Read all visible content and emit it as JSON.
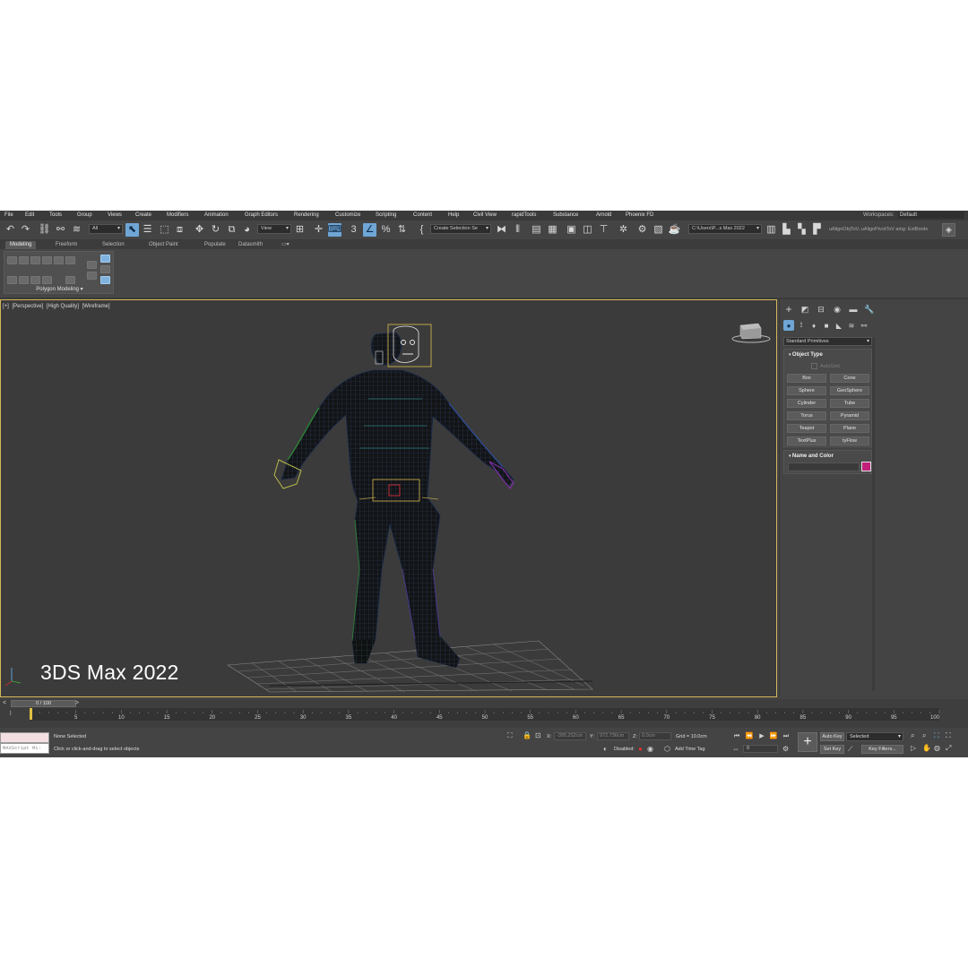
{
  "menu": [
    "File",
    "Edit",
    "Tools",
    "Group",
    "Views",
    "Create",
    "Modifiers",
    "Animation",
    "Graph Editors",
    "Rendering",
    "Customize",
    "Scripting",
    "Content",
    "Help",
    "Civil View",
    "rapidTools",
    "Substance",
    "Arnold",
    "Phoenix FD"
  ],
  "workspaces": {
    "label": "Workspaces:",
    "value": "Default"
  },
  "toolbar": {
    "filter_value": "All",
    "coord_value": "View",
    "selection_set": "Create Selection Se",
    "project_path": "C:\\Users\\P...s Max 2022",
    "extra_text": "uAlignObjToV..uAlignPivotToV aing: ExtBords"
  },
  "ribbon": {
    "tabs": [
      "Modeling",
      "Freeform",
      "Selection",
      "Object Paint",
      "Populate",
      "Datasmith"
    ],
    "active_tab": "Modeling",
    "group_label": "Polygon Modeling"
  },
  "viewport": {
    "labels": [
      "[+]",
      "[Perspective]",
      "[High Quality]",
      "[Wireframe]"
    ],
    "watermark": "3DS Max 2022",
    "border_color": "#d4b75a"
  },
  "command_panel": {
    "dropdown": "Standard Primitives",
    "object_type_title": "Object Type",
    "autogrid": "AutoGrid",
    "buttons": [
      "Box",
      "Cone",
      "Sphere",
      "GeoSphere",
      "Cylinder",
      "Tube",
      "Torus",
      "Pyramid",
      "Teapot",
      "Plane",
      "TextPlus",
      "tyFlow"
    ],
    "name_color_title": "Name and Color",
    "color": "#c2207a"
  },
  "timeline": {
    "slider_label": "0 / 100",
    "left_arrow": "<",
    "right_arrow": ">",
    "ticks": [
      "5",
      "10",
      "15",
      "20",
      "25",
      "30",
      "35",
      "40",
      "45",
      "50",
      "55",
      "60",
      "65",
      "70",
      "75",
      "80",
      "85",
      "90",
      "95",
      "100"
    ]
  },
  "status": {
    "maxscript_placeholder": "MAXScript Mi:",
    "selection_text": "None Selected",
    "prompt_text": "Click or click-and-drag to select objects",
    "x_label": "X:",
    "x_value": "-395.252cm",
    "y_label": "Y:",
    "y_value": "972.736cm",
    "z_label": "Z:",
    "z_value": "0.0cm",
    "grid_text": "Grid = 10.0cm",
    "disabled_text": "Disabled:",
    "add_time_tag": "Add Time Tag",
    "frame_value": "0",
    "auto_key": "Auto Key",
    "set_key": "Set Key",
    "key_mode": "Selected",
    "key_filters": "Key Filters..."
  }
}
